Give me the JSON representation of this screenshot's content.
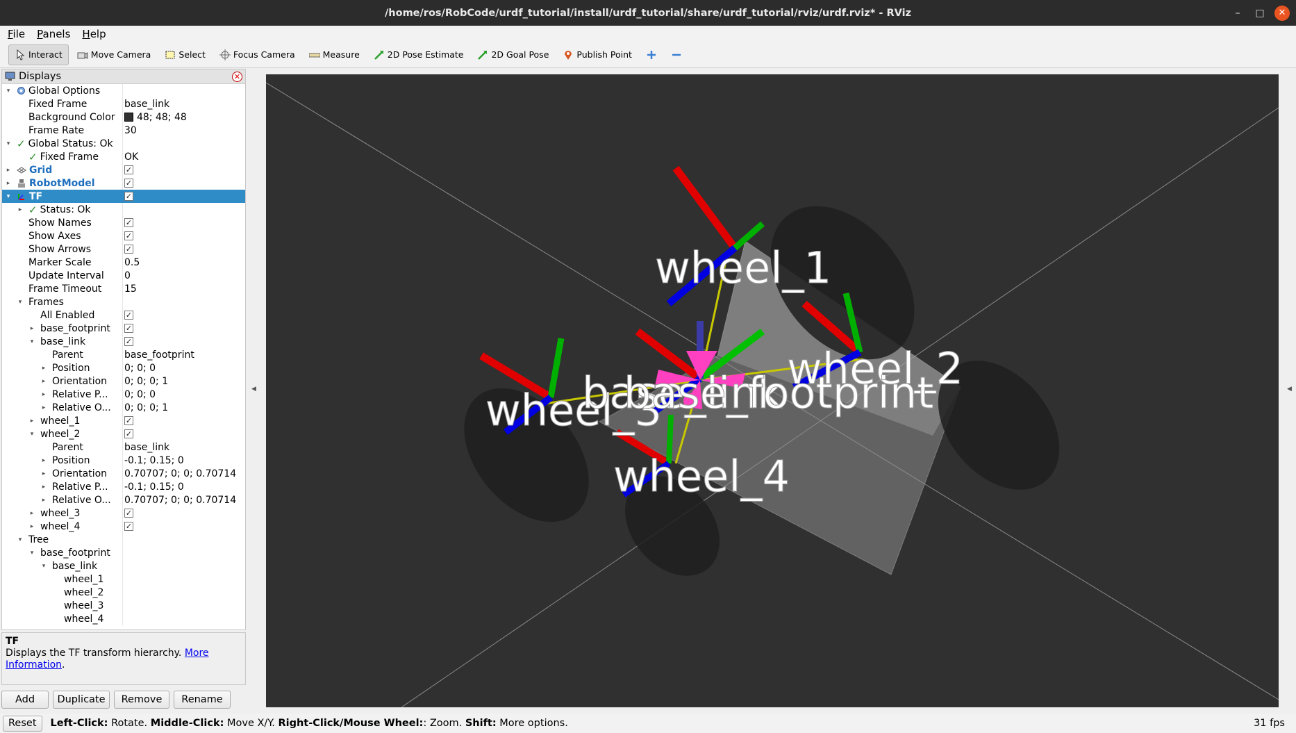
{
  "window": {
    "title": "/home/ros/RobCode/urdf_tutorial/install/urdf_tutorial/share/urdf_tutorial/rviz/urdf.rviz* - RViz"
  },
  "menu": [
    "File",
    "Panels",
    "Help"
  ],
  "toolbar": {
    "interact": "Interact",
    "move_camera": "Move Camera",
    "select": "Select",
    "focus_camera": "Focus Camera",
    "measure": "Measure",
    "pose_estimate": "2D Pose Estimate",
    "goal_pose": "2D Goal Pose",
    "publish_point": "Publish Point"
  },
  "displays": {
    "title": "Displays",
    "rows": [
      {
        "name": "Global Options",
        "value": ""
      },
      {
        "name": "Fixed Frame",
        "value": "base_link"
      },
      {
        "name": "Background Color",
        "value": "48; 48; 48"
      },
      {
        "name": "Frame Rate",
        "value": "30"
      },
      {
        "name": "Global Status: Ok",
        "value": ""
      },
      {
        "name": "Fixed Frame",
        "value": "OK"
      },
      {
        "name": "Grid",
        "value": "✓"
      },
      {
        "name": "RobotModel",
        "value": "✓"
      },
      {
        "name": "TF",
        "value": "✓"
      },
      {
        "name": "Status: Ok",
        "value": ""
      },
      {
        "name": "Show Names",
        "value": "✓"
      },
      {
        "name": "Show Axes",
        "value": "✓"
      },
      {
        "name": "Show Arrows",
        "value": "✓"
      },
      {
        "name": "Marker Scale",
        "value": "0.5"
      },
      {
        "name": "Update Interval",
        "value": "0"
      },
      {
        "name": "Frame Timeout",
        "value": "15"
      },
      {
        "name": "Frames",
        "value": ""
      },
      {
        "name": "All Enabled",
        "value": "✓"
      },
      {
        "name": "base_footprint",
        "value": "✓"
      },
      {
        "name": "base_link",
        "value": "✓"
      },
      {
        "name": "Parent",
        "value": "base_footprint"
      },
      {
        "name": "Position",
        "value": "0; 0; 0"
      },
      {
        "name": "Orientation",
        "value": "0; 0; 0; 1"
      },
      {
        "name": "Relative P...",
        "value": "0; 0; 0"
      },
      {
        "name": "Relative O...",
        "value": "0; 0; 0; 1"
      },
      {
        "name": "wheel_1",
        "value": "✓"
      },
      {
        "name": "wheel_2",
        "value": "✓"
      },
      {
        "name": "Parent",
        "value": "base_link"
      },
      {
        "name": "Position",
        "value": "-0.1; 0.15; 0"
      },
      {
        "name": "Orientation",
        "value": "0.70707; 0; 0; 0.70714"
      },
      {
        "name": "Relative P...",
        "value": "-0.1; 0.15; 0"
      },
      {
        "name": "Relative O...",
        "value": "0.70707; 0; 0; 0.70714"
      },
      {
        "name": "wheel_3",
        "value": "✓"
      },
      {
        "name": "wheel_4",
        "value": "✓"
      },
      {
        "name": "Tree",
        "value": ""
      },
      {
        "name": "base_footprint",
        "value": ""
      },
      {
        "name": "base_link",
        "value": ""
      },
      {
        "name": "wheel_1",
        "value": ""
      },
      {
        "name": "wheel_2",
        "value": ""
      },
      {
        "name": "wheel_3",
        "value": ""
      },
      {
        "name": "wheel_4",
        "value": ""
      }
    ]
  },
  "description": {
    "title": "TF",
    "text": "Displays the TF transform hierarchy.",
    "link": "More Information",
    "period": "."
  },
  "buttons": {
    "add": "Add",
    "duplicate": "Duplicate",
    "remove": "Remove",
    "rename": "Rename"
  },
  "view": {
    "background": "#303030",
    "labels": {
      "wheel_1": "wheel_1",
      "wheel_2": "wheel_2",
      "wheel_3": "wheel_3",
      "wheel_4": "wheel_4",
      "base_link": "base_link",
      "base_footprint": "base_footprint"
    }
  },
  "status": {
    "reset": "Reset",
    "hint_left_key": "Left-Click:",
    "hint_left": " Rotate. ",
    "hint_middle_key": "Middle-Click:",
    "hint_middle": " Move X/Y. ",
    "hint_right_key": "Right-Click/Mouse Wheel:",
    "hint_right": ": Zoom. ",
    "hint_shift_key": "Shift:",
    "hint_shift": " More options.",
    "fps": "31 fps"
  },
  "colors": {
    "selection": "#308cc6",
    "link_blue": "#1f6fbf",
    "status_green": "#2a8a2a",
    "x_axis": "#e00000",
    "y_axis": "#00c000",
    "z_axis": "#0000e0",
    "tf_link": "#c8c800",
    "arrow": "#ff40c0"
  }
}
